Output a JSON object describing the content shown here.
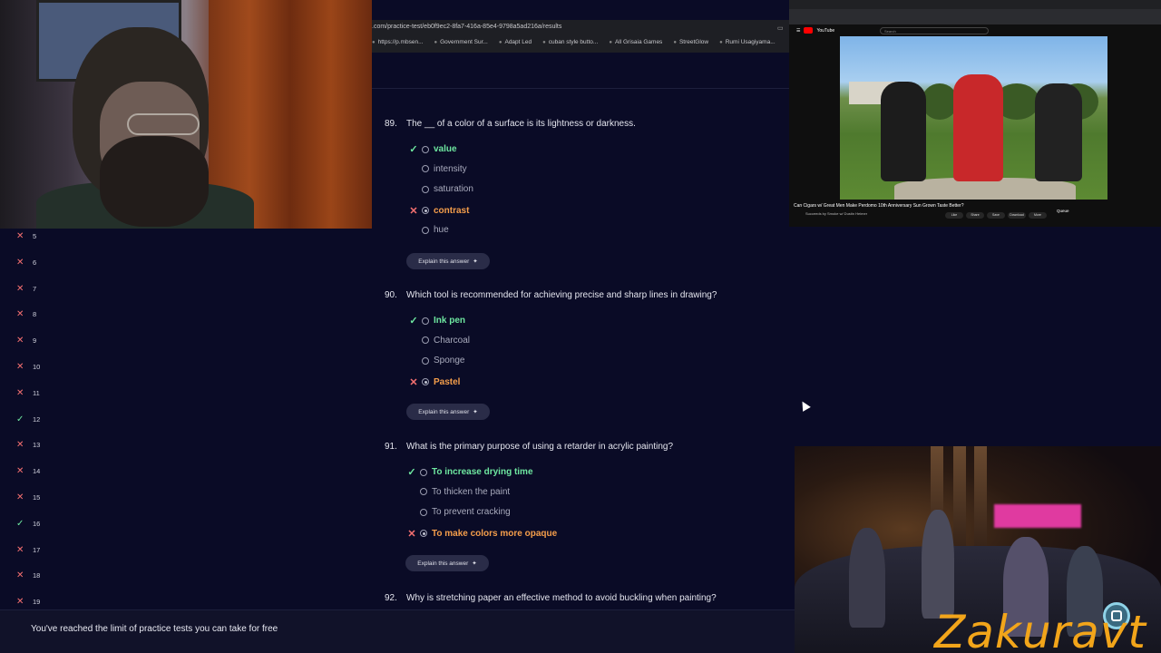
{
  "browser": {
    "url_prefix": ".com/practice-test/eb0f9ec2-8fa7-416a-85e4-9798a5ad216a/results",
    "bookmarks": [
      "https://p.mbsen...",
      "Government Sur...",
      "Adapt Led",
      "cuban style butto...",
      "All Grisaia Games",
      "StreetGlow",
      "Rumi Usagiyama..."
    ]
  },
  "questions": [
    {
      "number": "89.",
      "text": "The __ of a color of a surface is its lightness or darkness.",
      "options": [
        {
          "label": "value",
          "state": "correct"
        },
        {
          "label": "intensity",
          "state": "neutral"
        },
        {
          "label": "saturation",
          "state": "neutral"
        },
        {
          "label": "contrast",
          "state": "wrong"
        },
        {
          "label": "hue",
          "state": "neutral"
        }
      ],
      "explain": "Explain this answer"
    },
    {
      "number": "90.",
      "text": "Which tool is recommended for achieving precise and sharp lines in drawing?",
      "options": [
        {
          "label": "Ink pen",
          "state": "correct"
        },
        {
          "label": "Charcoal",
          "state": "neutral"
        },
        {
          "label": "Sponge",
          "state": "neutral"
        },
        {
          "label": "Pastel",
          "state": "wrong"
        }
      ],
      "explain": "Explain this answer"
    },
    {
      "number": "91.",
      "text": "What is the primary purpose of using a retarder in acrylic painting?",
      "options": [
        {
          "label": "To increase drying time",
          "state": "correct"
        },
        {
          "label": "To thicken the paint",
          "state": "neutral"
        },
        {
          "label": "To prevent cracking",
          "state": "neutral"
        },
        {
          "label": "To make colors more opaque",
          "state": "wrong"
        }
      ],
      "explain": "Explain this answer"
    },
    {
      "number": "92.",
      "text": "Why is stretching paper an effective method to avoid buckling when painting?"
    }
  ],
  "sidebar": {
    "items": [
      {
        "n": "5",
        "ok": false
      },
      {
        "n": "6",
        "ok": false
      },
      {
        "n": "7",
        "ok": false
      },
      {
        "n": "8",
        "ok": false
      },
      {
        "n": "9",
        "ok": false
      },
      {
        "n": "10",
        "ok": false
      },
      {
        "n": "11",
        "ok": false
      },
      {
        "n": "12",
        "ok": true
      },
      {
        "n": "13",
        "ok": false
      },
      {
        "n": "14",
        "ok": false
      },
      {
        "n": "15",
        "ok": false
      },
      {
        "n": "16",
        "ok": true
      },
      {
        "n": "17",
        "ok": false
      },
      {
        "n": "18",
        "ok": false
      },
      {
        "n": "19",
        "ok": false
      }
    ]
  },
  "banner": {
    "text": "You've reached the limit of practice tests you can take for free"
  },
  "youtube": {
    "logo": "YouTube",
    "search_placeholder": "Search",
    "title": "Can Cigars w/ Great Men Make Perdomo 10th Anniversary Sun Grown Taste Better?",
    "channel": "Succeeds by Smoke w/ Dustin Heimer",
    "actions": [
      "Like",
      "Share",
      "Save",
      "Download",
      "More"
    ],
    "queue_label": "Queue"
  },
  "watermark": "Zakuravt",
  "colors": {
    "correct": "#6ee7a0",
    "wrong_text": "#f59e4b",
    "wrong_mark": "#f87171",
    "bg": "#0a0b26"
  }
}
